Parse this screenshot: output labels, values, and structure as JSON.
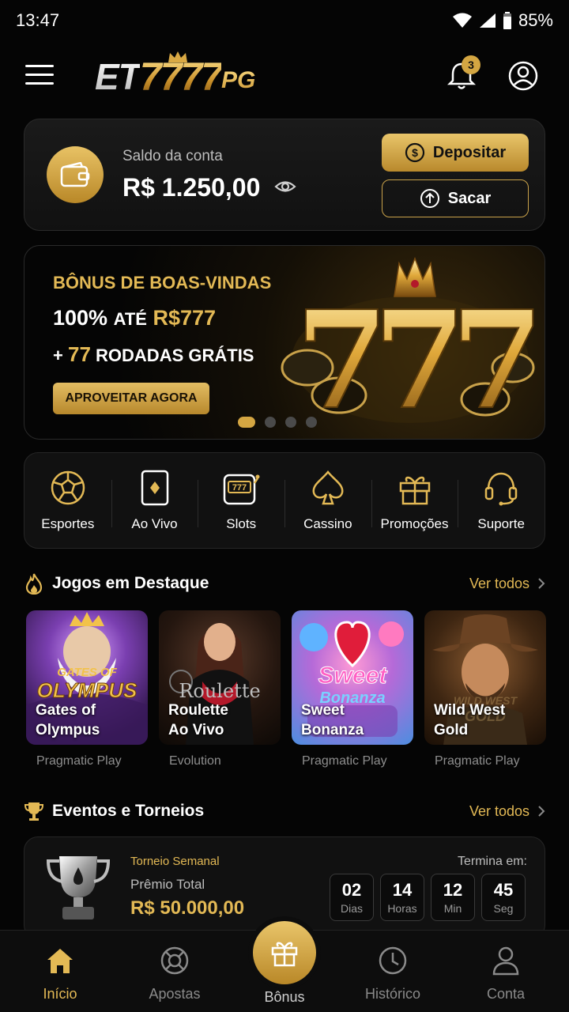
{
  "status": {
    "time": "13:47",
    "battery": "85%"
  },
  "header": {
    "logo_et": "ET",
    "logo_sevens": "7777",
    "logo_pg": "PG",
    "notification_count": "3"
  },
  "balance": {
    "label": "Saldo da conta",
    "value": "R$ 1.250,00",
    "deposit_label": "Depositar",
    "withdraw_label": "Sacar"
  },
  "banner": {
    "title": "BÔNUS DE BOAS-VINDAS",
    "line1_a": "100%",
    "line1_b": "ATÉ",
    "line1_c": "R$777",
    "line2_a": "+",
    "line2_b": "77",
    "line2_c": "RODADAS GRÁTIS",
    "cta": "APROVEITAR AGORA",
    "art_text": "777",
    "active_slide": 1,
    "slides": 4
  },
  "quick_menu": [
    {
      "label": "Esportes",
      "icon": "soccer-ball-icon"
    },
    {
      "label": "Ao Vivo",
      "icon": "playing-card-icon"
    },
    {
      "label": "Slots",
      "icon": "slot-machine-icon"
    },
    {
      "label": "Cassino",
      "icon": "spade-icon"
    },
    {
      "label": "Promoções",
      "icon": "gift-icon"
    },
    {
      "label": "Suporte",
      "icon": "headset-icon"
    }
  ],
  "featured": {
    "title": "Jogos em Destaque",
    "more": "Ver todos",
    "games": [
      {
        "name_1": "Gates of",
        "name_2": "Olympus",
        "provider": "Pragmatic Play",
        "art_1": "GATES OF",
        "art_2": "OLYMPUS"
      },
      {
        "name_1": "Roulette",
        "name_2": "Ao Vivo",
        "provider": "Evolution",
        "art_1": "Roulette"
      },
      {
        "name_1": "Sweet",
        "name_2": "Bonanza",
        "provider": "Pragmatic Play",
        "art_1": "Sweet",
        "art_2": "Bonanza"
      },
      {
        "name_1": "Wild West",
        "name_2": "Gold",
        "provider": "Pragmatic Play",
        "art_1": "WILD WEST",
        "art_2": "GOLD"
      }
    ]
  },
  "events": {
    "title": "Eventos e Torneios",
    "more": "Ver todos",
    "tag": "Torneio Semanal",
    "prize_label": "Prêmio Total",
    "prize": "R$ 50.000,00",
    "ends_label": "Termina em:",
    "countdown": [
      {
        "value": "02",
        "unit": "Dias"
      },
      {
        "value": "14",
        "unit": "Horas"
      },
      {
        "value": "12",
        "unit": "Min"
      },
      {
        "value": "45",
        "unit": "Seg"
      }
    ]
  },
  "nav": {
    "home": "Início",
    "bets": "Apostas",
    "bonus": "Bônus",
    "history": "Histórico",
    "account": "Conta"
  },
  "colors": {
    "gold": "#e3b955",
    "background": "#050505",
    "card": "#111111"
  }
}
